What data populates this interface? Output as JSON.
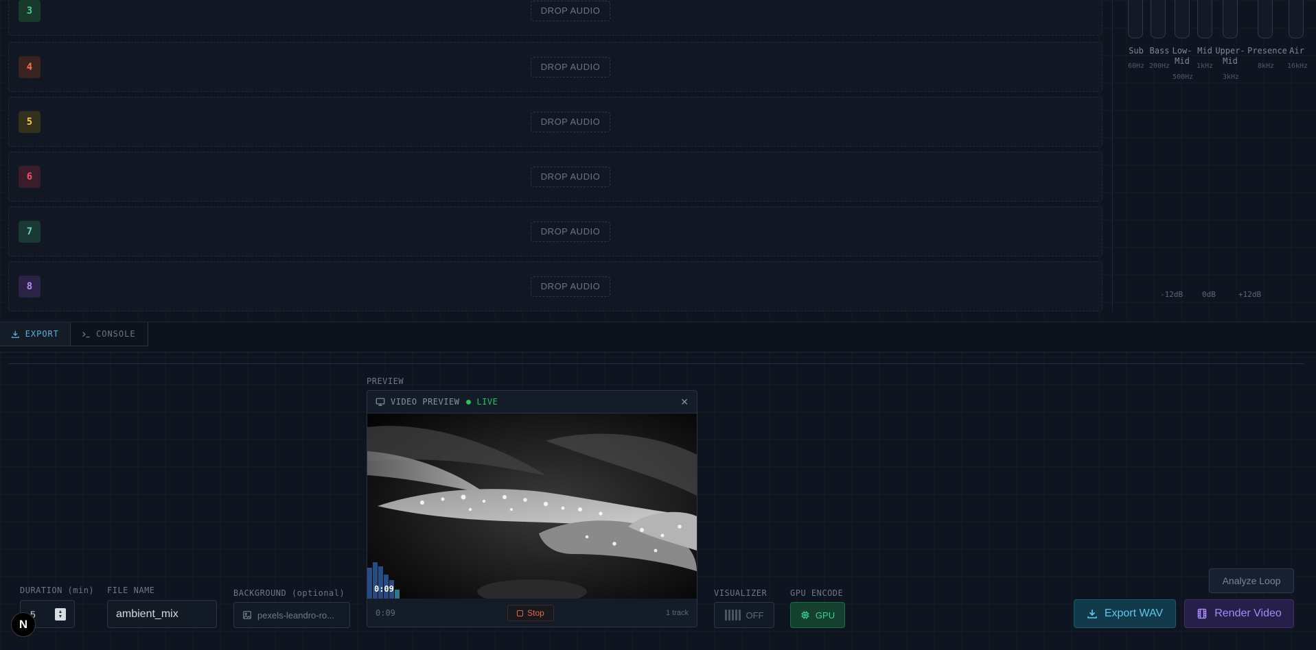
{
  "tracks": [
    {
      "number": "3",
      "drop_label": "DROP AUDIO",
      "color": "#3ecf8e",
      "bg": "#183a2c"
    },
    {
      "number": "4",
      "drop_label": "DROP AUDIO",
      "color": "#f0743f",
      "bg": "#3a2220"
    },
    {
      "number": "5",
      "drop_label": "DROP AUDIO",
      "color": "#f2c94c",
      "bg": "#33301c"
    },
    {
      "number": "6",
      "drop_label": "DROP AUDIO",
      "color": "#f0516e",
      "bg": "#3a1c2a"
    },
    {
      "number": "7",
      "drop_label": "DROP AUDIO",
      "color": "#5fd3b4",
      "bg": "#1a3834"
    },
    {
      "number": "8",
      "drop_label": "DROP AUDIO",
      "color": "#b98af5",
      "bg": "#2a2345"
    }
  ],
  "eq": {
    "bands": [
      {
        "label": "Sub",
        "freq": "60Hz"
      },
      {
        "label": "Bass",
        "freq": "200Hz"
      },
      {
        "label": "Low-Mid",
        "freq": "500Hz"
      },
      {
        "label": "Mid",
        "freq": "1kHz"
      },
      {
        "label": "Upper-Mid",
        "freq": "3kHz"
      },
      {
        "label": "Presence",
        "freq": "8kHz"
      },
      {
        "label": "Air",
        "freq": "16kHz"
      }
    ],
    "scale": [
      "-12dB",
      "0dB",
      "+12dB"
    ]
  },
  "tabs": {
    "export": "EXPORT",
    "console": "CONSOLE"
  },
  "export": {
    "duration_label": "DURATION (min)",
    "duration_value": "5",
    "filename_label": "FILE NAME",
    "filename_value": "ambient_mix",
    "background_label": "BACKGROUND (optional)",
    "background_value": "pexels-leandro-ro...",
    "preview_label": "PREVIEW",
    "visualizer_label": "VISUALIZER",
    "visualizer_value": "OFF",
    "gpu_label": "GPU ENCODE",
    "gpu_value": "GPU",
    "analyze_label": "Analyze Loop",
    "export_wav_label": "Export WAV",
    "render_video_label": "Render Video"
  },
  "preview": {
    "title": "VIDEO PREVIEW",
    "live": "LIVE",
    "timecode": "0:09",
    "footer_time": "0:09",
    "stop_label": "Stop",
    "track_count": "1 track"
  },
  "logo_letter": "N"
}
